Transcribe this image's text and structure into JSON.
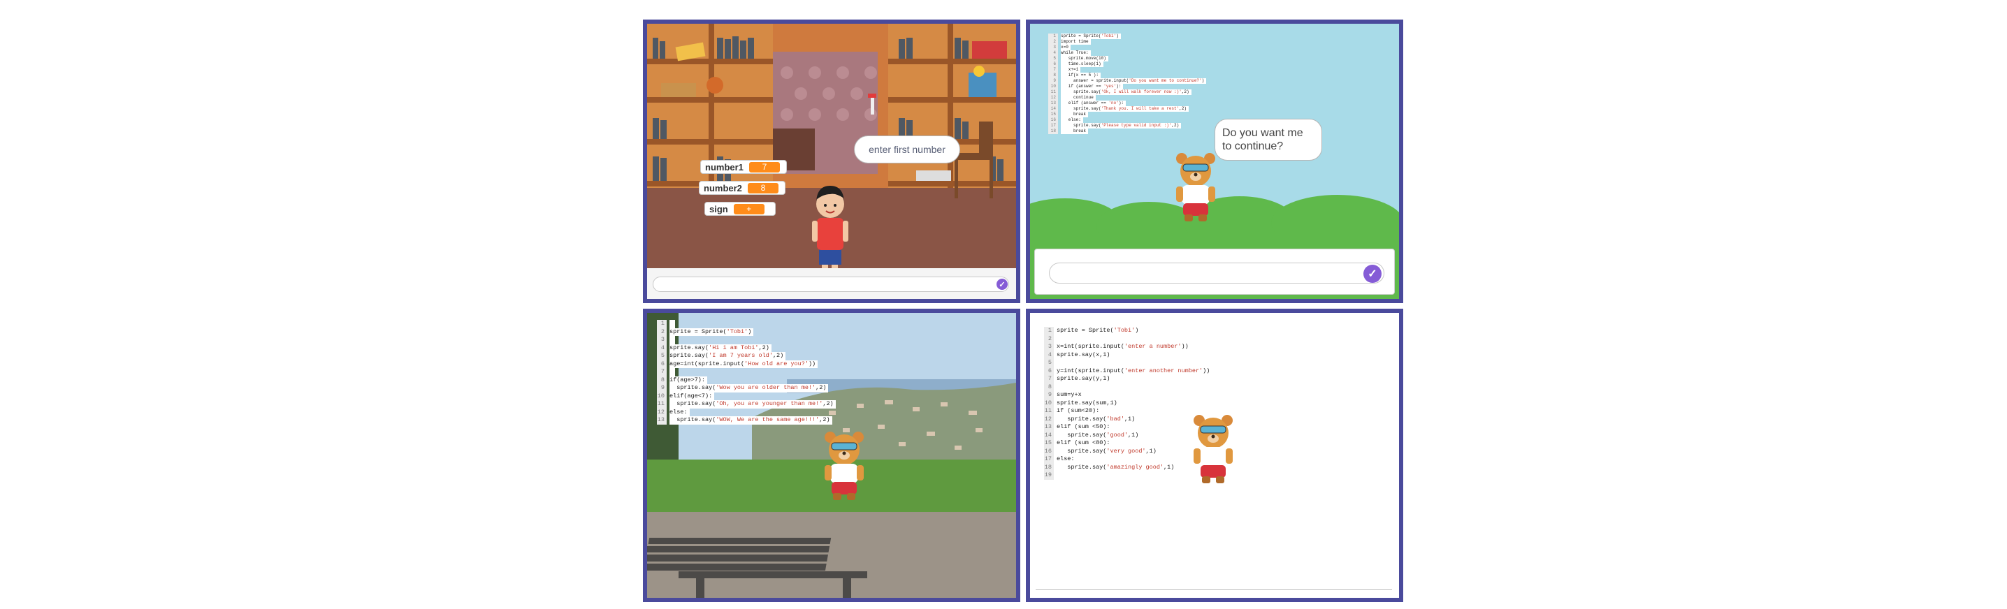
{
  "panel1": {
    "monitors": [
      {
        "label": "number1",
        "value": "7"
      },
      {
        "label": "number2",
        "value": "8"
      },
      {
        "label": "sign",
        "value": "+"
      }
    ],
    "speech": "enter first number",
    "answer_placeholder": ""
  },
  "panel2": {
    "code": [
      {
        "n": "1",
        "t": "sprite = Sprite('Tobi')"
      },
      {
        "n": "2",
        "t": "import time"
      },
      {
        "n": "3",
        "t": "x=0"
      },
      {
        "n": "4",
        "t": "while True:"
      },
      {
        "n": "5",
        "t": "   sprite.move(10)"
      },
      {
        "n": "6",
        "t": "   time.sleep(1)"
      },
      {
        "n": "7",
        "t": "   x+=1"
      },
      {
        "n": "8",
        "t": "   if(x == 5 ):"
      },
      {
        "n": "9",
        "t": "     answer = sprite.input('Do you want me to continue?')"
      },
      {
        "n": "10",
        "t": "   if (answer == 'yes'):"
      },
      {
        "n": "11",
        "t": "     sprite.say('Ok, I will walk forever now :)',2)"
      },
      {
        "n": "12",
        "t": "     continue"
      },
      {
        "n": "13",
        "t": "   elif (answer == 'no'):"
      },
      {
        "n": "14",
        "t": "     sprite.say('Thank you. I will take a rest',2)"
      },
      {
        "n": "15",
        "t": "     break"
      },
      {
        "n": "16",
        "t": "   else:"
      },
      {
        "n": "17",
        "t": "     sprite.say('Please type valid input :)',2)"
      },
      {
        "n": "18",
        "t": "     break"
      }
    ],
    "speech": "Do you want me to continue?",
    "answer_placeholder": ""
  },
  "panel3": {
    "code": [
      {
        "n": "1",
        "t": ""
      },
      {
        "n": "2",
        "t": "sprite = Sprite('Tobi')"
      },
      {
        "n": "3",
        "t": ""
      },
      {
        "n": "4",
        "t": "sprite.say('Hi i am Tobi',2)"
      },
      {
        "n": "5",
        "t": "sprite.say('I am 7 years old',2)"
      },
      {
        "n": "6",
        "t": "age=int(sprite.input('How old are you?'))"
      },
      {
        "n": "7",
        "t": ""
      },
      {
        "n": "8",
        "t": "if(age>7):"
      },
      {
        "n": "9",
        "t": "  sprite.say('Wow you are older than me!',2)"
      },
      {
        "n": "10",
        "t": "elif(age<7):"
      },
      {
        "n": "11",
        "t": "  sprite.say('Oh, you are younger than me!',2)"
      },
      {
        "n": "12",
        "t": "else:"
      },
      {
        "n": "13",
        "t": "  sprite.say('WOW, We are the same age!!!',2)"
      }
    ]
  },
  "panel4": {
    "code": [
      {
        "n": "1",
        "t": "sprite = Sprite('Tobi')"
      },
      {
        "n": "2",
        "t": ""
      },
      {
        "n": "3",
        "t": "x=int(sprite.input('enter a number'))"
      },
      {
        "n": "4",
        "t": "sprite.say(x,1)"
      },
      {
        "n": "5",
        "t": ""
      },
      {
        "n": "6",
        "t": "y=int(sprite.input('enter another number'))"
      },
      {
        "n": "7",
        "t": "sprite.say(y,1)"
      },
      {
        "n": "8",
        "t": ""
      },
      {
        "n": "9",
        "t": "sum=y+x"
      },
      {
        "n": "10",
        "t": "sprite.say(sum,1)"
      },
      {
        "n": "11",
        "t": "if (sum<20):"
      },
      {
        "n": "12",
        "t": "   sprite.say('bad',1)"
      },
      {
        "n": "13",
        "t": "elif (sum <50):"
      },
      {
        "n": "14",
        "t": "   sprite.say('good',1)"
      },
      {
        "n": "15",
        "t": "elif (sum <80):"
      },
      {
        "n": "16",
        "t": "   sprite.say('very good',1)"
      },
      {
        "n": "17",
        "t": "else:"
      },
      {
        "n": "18",
        "t": "   sprite.say('amazingly good',1)"
      },
      {
        "n": "19",
        "t": ""
      }
    ]
  },
  "icons": {
    "check": "check-circle-icon",
    "sprite_tobi": "bear-sprite",
    "sprite_girl": "girl-sprite"
  },
  "colors": {
    "frame": "#4a4a9c",
    "monitor_value": "#ff8c1a",
    "check_button": "#855cd6",
    "code_string": "#c0392b"
  }
}
